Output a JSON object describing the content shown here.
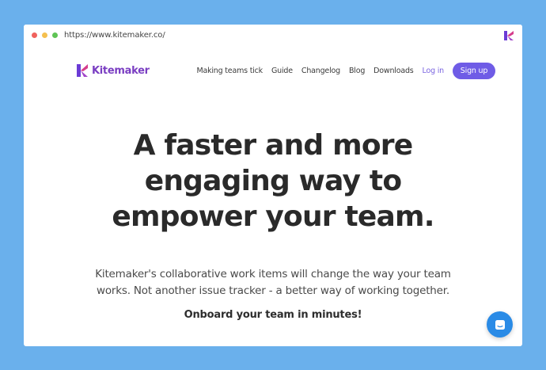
{
  "browser": {
    "url": "https://www.kitemaker.co/"
  },
  "header": {
    "brand": "Kitemaker",
    "nav": [
      {
        "label": "Making teams tick"
      },
      {
        "label": "Guide"
      },
      {
        "label": "Changelog"
      },
      {
        "label": "Blog"
      },
      {
        "label": "Downloads"
      }
    ],
    "login_label": "Log in",
    "signup_label": "Sign up"
  },
  "hero": {
    "headline_lines": [
      "A faster and more",
      "engaging way to",
      "empower your team."
    ],
    "subtitle_lines": [
      "Kitemaker's collaborative work items will change the way your team",
      "works. Not another issue tracker - a better way of working together."
    ],
    "cta_text": "Onboard your team in minutes!"
  },
  "icons": {
    "traffic_lights": [
      "close-dot",
      "minimize-dot",
      "maximize-dot"
    ],
    "brand_logo": "kitemaker-logo-icon",
    "chat": "chat-icon"
  },
  "colors": {
    "background": "#6ab0ec",
    "brand": "#7a3ec2",
    "accent": "#6f5ce6",
    "chat": "#2a8be6"
  }
}
